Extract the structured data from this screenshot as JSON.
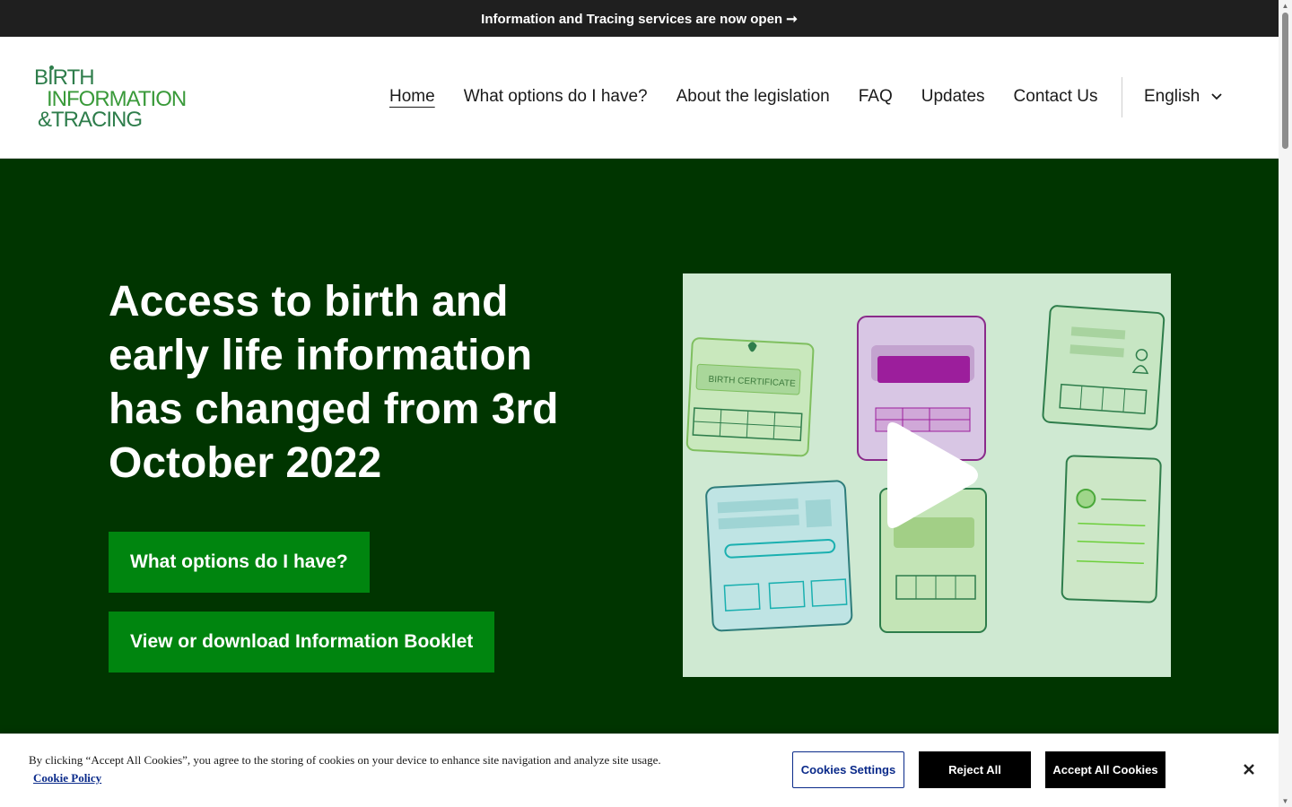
{
  "announcement": {
    "text": "Information and Tracing services are now open",
    "arrow": "➞"
  },
  "logo": {
    "line1": "BIRTH",
    "line2": "INFORMATION",
    "line3": "&TRACING"
  },
  "nav": {
    "items": [
      {
        "label": "Home",
        "active": true
      },
      {
        "label": "What options do I have?"
      },
      {
        "label": "About the legislation"
      },
      {
        "label": "FAQ"
      },
      {
        "label": "Updates"
      },
      {
        "label": "Contact Us"
      }
    ],
    "language": "English"
  },
  "hero": {
    "title": "Access to birth and early life information has changed from 3rd October 2022",
    "primary_button": "What options do I have?",
    "secondary_button": "View or download Information Booklet",
    "video": {
      "certificate_label": "BIRTH CERTIFICATE",
      "play_icon": "play-icon"
    }
  },
  "cookie_banner": {
    "text": "By clicking “Accept All Cookies”, you agree to the storing of cookies on your device to enhance site navigation and analyze site usage.",
    "policy_link": "Cookie Policy",
    "settings_button": "Cookies Settings",
    "reject_button": "Reject All",
    "accept_button": "Accept All Cookies"
  },
  "colors": {
    "announce_bg": "#1f1f1f",
    "hero_bg": "#003500",
    "button_green": "#00850f",
    "video_bg": "#cfe9d2",
    "logo_green": "#2e7d4b"
  }
}
